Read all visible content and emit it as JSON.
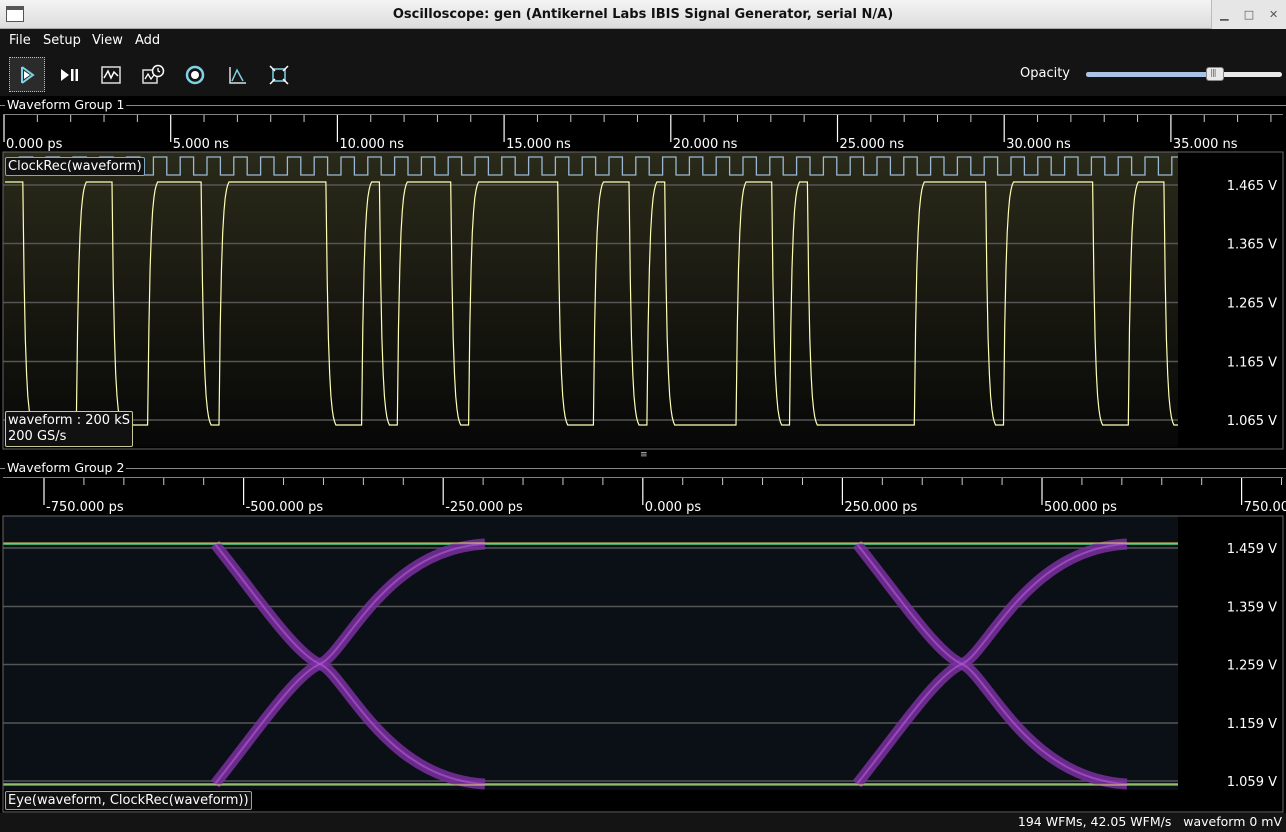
{
  "window": {
    "title": "Oscilloscope: gen (Antikernel Labs IBIS Signal Generator, serial N/A)",
    "buttons": [
      "minimize",
      "maximize",
      "close"
    ]
  },
  "menubar": {
    "items": [
      "File",
      "Setup",
      "View",
      "Add"
    ]
  },
  "toolbar": {
    "buttons": [
      {
        "name": "start-trigger",
        "icon": "play-icon"
      },
      {
        "name": "single-trigger",
        "icon": "play-pause-icon"
      },
      {
        "name": "force-trigger",
        "icon": "waveform-icon"
      },
      {
        "name": "history",
        "icon": "history-icon"
      },
      {
        "name": "refresh",
        "icon": "refresh-icon"
      },
      {
        "name": "measure",
        "icon": "measure-icon"
      },
      {
        "name": "fullscreen",
        "icon": "fullscreen-icon"
      }
    ],
    "opacity_label": "Opacity",
    "opacity_value": 0.66
  },
  "group1": {
    "title": "Waveform Group 1",
    "timeline": [
      "0.000 ps",
      "5.000 ns",
      "10.000 ns",
      "15.000 ns",
      "20.000 ns",
      "25.000 ns",
      "30.000 ns",
      "35.000 ns"
    ],
    "volt_labels": [
      "1.465 V",
      "1.365 V",
      "1.265 V",
      "1.165 V",
      "1.065 V"
    ],
    "clock_label": "ClockRec(waveform)",
    "info_line1": "waveform : 200 kS",
    "info_line2": "200 GS/s",
    "trace_color": "#ffffb4",
    "clock_color": "#9ab8d4",
    "bit_pattern": "100011001110111111001011101111100110100001101000000111101111100110"
  },
  "group2": {
    "title": "Waveform Group 2",
    "timeline": [
      "-750.000 ps",
      "-500.000 ps",
      "-250.000 ps",
      "0.000 ps",
      "250.000 ps",
      "500.000 ps",
      "750.00"
    ],
    "volt_labels": [
      "1.459 V",
      "1.359 V",
      "1.259 V",
      "1.159 V",
      "1.059 V"
    ],
    "eye_label": "Eye(waveform, ClockRec(waveform))",
    "eye_color": "#7a2fa0"
  },
  "status": {
    "text": "194 WFMs, 42.05 WFM/s   waveform 0 mV"
  }
}
